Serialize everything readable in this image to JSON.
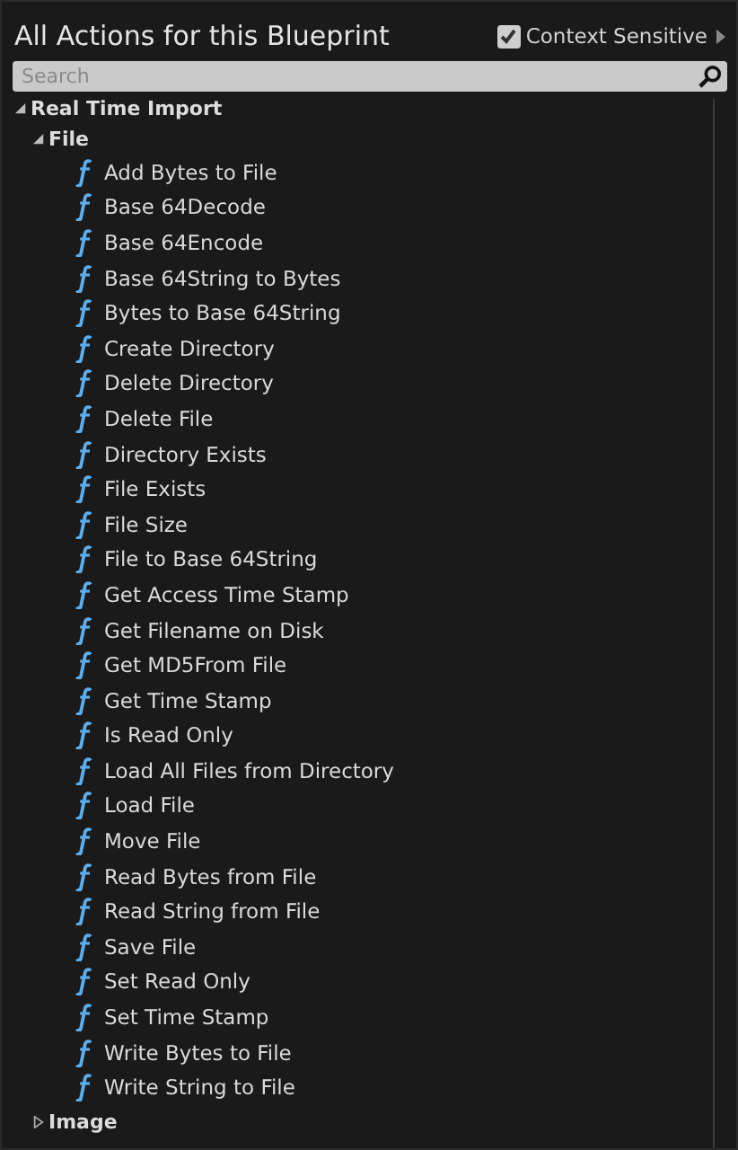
{
  "window": {
    "title": "All Actions for this Blueprint"
  },
  "context_sensitive": {
    "label": "Context Sensitive",
    "checked": true
  },
  "search": {
    "placeholder": "Search"
  },
  "tree": [
    {
      "label": "Real Time Import",
      "expanded": true,
      "children": [
        {
          "label": "File",
          "expanded": true,
          "children": [
            {
              "label": "Add Bytes to File",
              "kind": "function"
            },
            {
              "label": "Base 64Decode",
              "kind": "function"
            },
            {
              "label": "Base 64Encode",
              "kind": "function"
            },
            {
              "label": "Base 64String to Bytes",
              "kind": "function"
            },
            {
              "label": "Bytes to Base 64String",
              "kind": "function"
            },
            {
              "label": "Create Directory",
              "kind": "function"
            },
            {
              "label": "Delete Directory",
              "kind": "function"
            },
            {
              "label": "Delete File",
              "kind": "function"
            },
            {
              "label": "Directory Exists",
              "kind": "function"
            },
            {
              "label": "File Exists",
              "kind": "function"
            },
            {
              "label": "File Size",
              "kind": "function"
            },
            {
              "label": "File to Base 64String",
              "kind": "function"
            },
            {
              "label": "Get Access Time Stamp",
              "kind": "function"
            },
            {
              "label": "Get Filename on Disk",
              "kind": "function"
            },
            {
              "label": "Get MD5From File",
              "kind": "function"
            },
            {
              "label": "Get Time Stamp",
              "kind": "function"
            },
            {
              "label": "Is Read Only",
              "kind": "function"
            },
            {
              "label": "Load All Files from Directory",
              "kind": "function"
            },
            {
              "label": "Load File",
              "kind": "function"
            },
            {
              "label": "Move File",
              "kind": "function"
            },
            {
              "label": "Read Bytes from File",
              "kind": "function"
            },
            {
              "label": "Read String from File",
              "kind": "function"
            },
            {
              "label": "Save File",
              "kind": "function"
            },
            {
              "label": "Set Read Only",
              "kind": "function"
            },
            {
              "label": "Set Time Stamp",
              "kind": "function"
            },
            {
              "label": "Write Bytes to File",
              "kind": "function"
            },
            {
              "label": "Write String to File",
              "kind": "function"
            }
          ]
        },
        {
          "label": "Image",
          "expanded": false
        }
      ]
    }
  ]
}
